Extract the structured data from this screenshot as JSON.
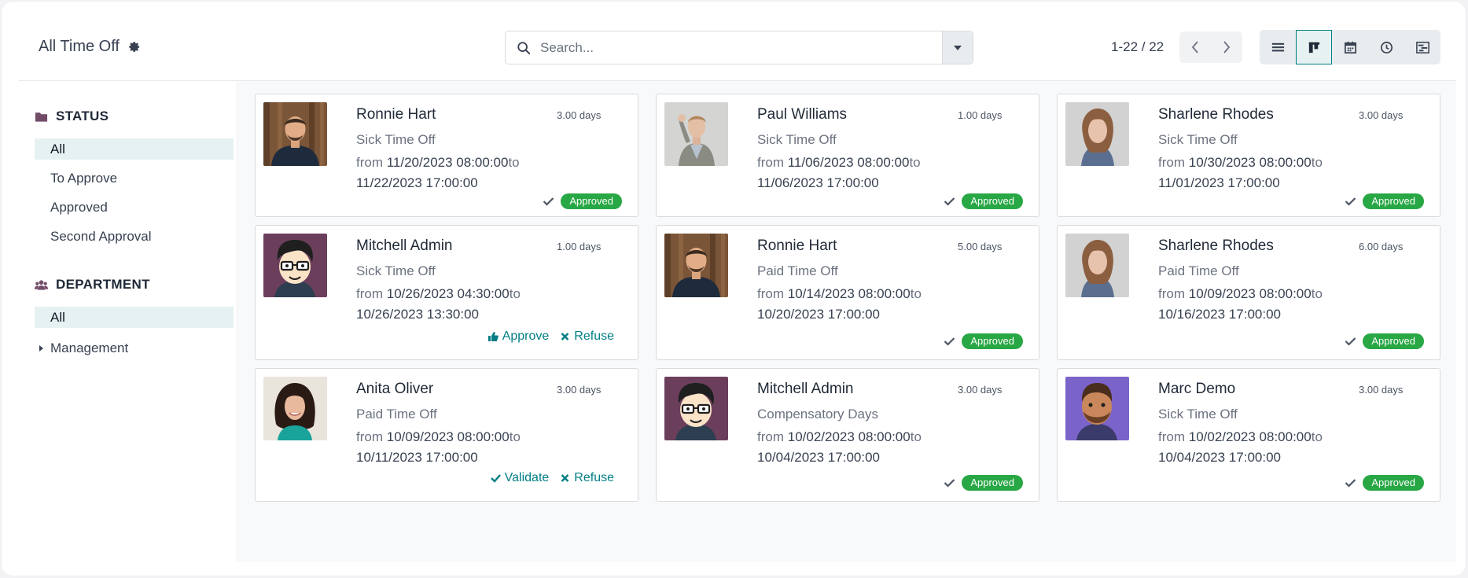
{
  "colors": {
    "accent": "#017e84",
    "approved": "#28a745",
    "sidebar_icon": "#714b67"
  },
  "breadcrumb": {
    "title": "All Time Off",
    "icon": "gear-icon"
  },
  "search": {
    "placeholder": "Search...",
    "value": ""
  },
  "pager": {
    "value": "1-22 / 22"
  },
  "views": [
    "list-view-icon",
    "kanban-view-icon",
    "calendar-view-icon",
    "activity-view-icon",
    "gantt-view-icon"
  ],
  "sidebar": {
    "status": {
      "title": "STATUS",
      "items": [
        "All",
        "To Approve",
        "Approved",
        "Second Approval"
      ]
    },
    "department": {
      "title": "DEPARTMENT",
      "items": [
        "All",
        "Management"
      ]
    }
  },
  "cards": [
    {
      "name": "Ronnie Hart",
      "days": "3.00 days",
      "type": "Sick Time Off",
      "from_label": "from ",
      "start": "11/20/2023 08:00:00",
      "to_label": "to",
      "end": "11/22/2023 17:00:00",
      "status": "Approved"
    },
    {
      "name": "Paul Williams",
      "days": "1.00 days",
      "type": "Sick Time Off",
      "from_label": "from ",
      "start": "11/06/2023 08:00:00",
      "to_label": "to",
      "end": "11/06/2023 17:00:00",
      "status": "Approved"
    },
    {
      "name": "Sharlene Rhodes",
      "days": "3.00 days",
      "type": "Sick Time Off",
      "from_label": "from ",
      "start": "10/30/2023 08:00:00",
      "to_label": "to",
      "end": "11/01/2023 17:00:00",
      "status": "Approved"
    },
    {
      "name": "Mitchell Admin",
      "days": "1.00 days",
      "type": "Sick Time Off",
      "from_label": "from ",
      "start": "10/26/2023 04:30:00",
      "to_label": "to",
      "end": "10/26/2023 13:30:00",
      "actions": [
        "Approve",
        "Refuse"
      ]
    },
    {
      "name": "Ronnie Hart",
      "days": "5.00 days",
      "type": "Paid Time Off",
      "from_label": "from ",
      "start": "10/14/2023 08:00:00",
      "to_label": "to",
      "end": "10/20/2023 17:00:00",
      "status": "Approved"
    },
    {
      "name": "Sharlene Rhodes",
      "days": "6.00 days",
      "type": "Paid Time Off",
      "from_label": "from ",
      "start": "10/09/2023 08:00:00",
      "to_label": "to",
      "end": "10/16/2023 17:00:00",
      "status": "Approved"
    },
    {
      "name": "Anita Oliver",
      "days": "3.00 days",
      "type": "Paid Time Off",
      "from_label": "from ",
      "start": "10/09/2023 08:00:00",
      "to_label": "to",
      "end": "10/11/2023 17:00:00",
      "actions": [
        "Validate",
        "Refuse"
      ]
    },
    {
      "name": "Mitchell Admin",
      "days": "3.00 days",
      "type": "Compensatory Days",
      "from_label": "from ",
      "start": "10/02/2023 08:00:00",
      "to_label": "to",
      "end": "10/04/2023 17:00:00",
      "status": "Approved"
    },
    {
      "name": "Marc Demo",
      "days": "3.00 days",
      "type": "Sick Time Off",
      "from_label": "from ",
      "start": "10/02/2023 08:00:00",
      "to_label": "to",
      "end": "10/04/2023 17:00:00",
      "status": "Approved"
    }
  ]
}
